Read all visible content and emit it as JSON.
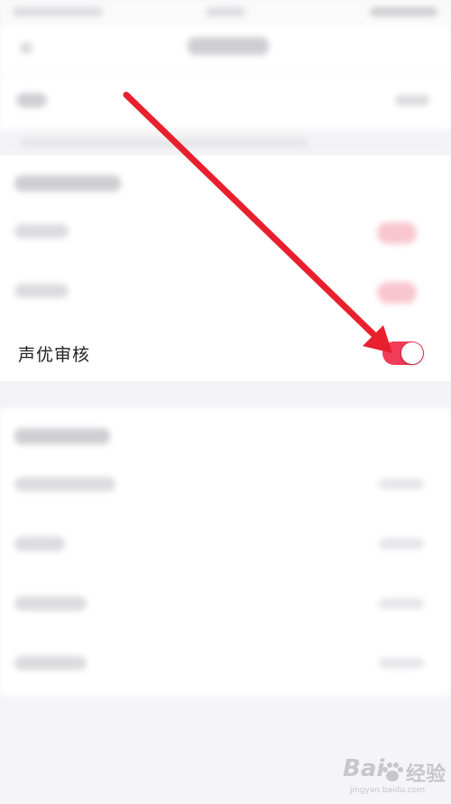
{
  "settings": {
    "voice_review": {
      "label": "声优审核",
      "enabled": true
    }
  },
  "colors": {
    "toggle_on": "#f23c57",
    "annotation_arrow": "#e8202e",
    "page_background": "#f5f5f7"
  },
  "watermark": {
    "brand": "Bai",
    "suffix": "经验",
    "url": "jingyan.baidu.com"
  }
}
